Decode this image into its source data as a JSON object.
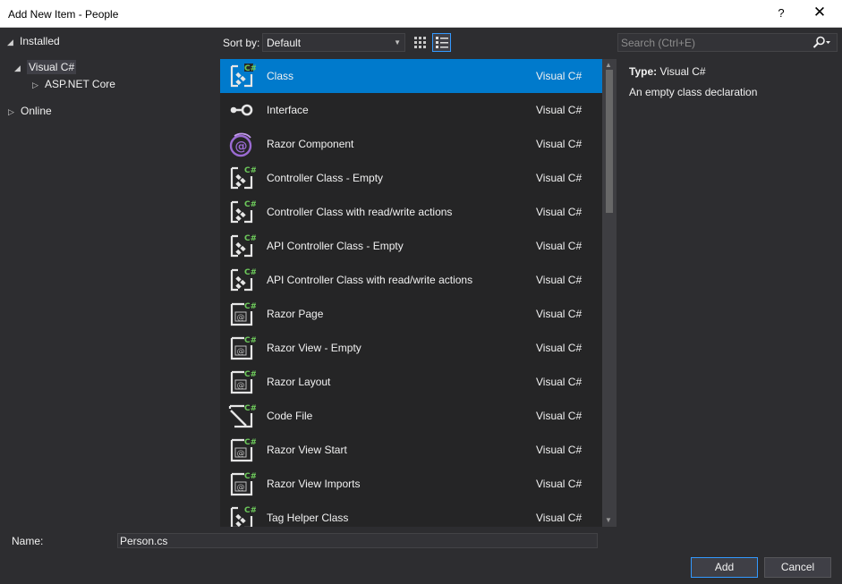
{
  "window": {
    "title": "Add New Item - People",
    "help_glyph": "?",
    "close_glyph": "✕"
  },
  "left_tree": {
    "installed": "Installed",
    "visual_csharp": "Visual C#",
    "aspnet_core": "ASP.NET Core",
    "online": "Online"
  },
  "toolbar": {
    "sort_label": "Sort by:",
    "sort_value": "Default",
    "search_placeholder": "Search (Ctrl+E)"
  },
  "templates": [
    {
      "name": "Class",
      "lang": "Visual C#",
      "icon": "class-icon"
    },
    {
      "name": "Interface",
      "lang": "Visual C#",
      "icon": "interface-icon"
    },
    {
      "name": "Razor Component",
      "lang": "Visual C#",
      "icon": "razor-component-icon"
    },
    {
      "name": "Controller Class - Empty",
      "lang": "Visual C#",
      "icon": "class-icon"
    },
    {
      "name": "Controller Class with read/write actions",
      "lang": "Visual C#",
      "icon": "class-icon"
    },
    {
      "name": "API Controller Class - Empty",
      "lang": "Visual C#",
      "icon": "class-icon"
    },
    {
      "name": "API Controller Class with read/write actions",
      "lang": "Visual C#",
      "icon": "class-icon"
    },
    {
      "name": "Razor Page",
      "lang": "Visual C#",
      "icon": "razor-page-icon"
    },
    {
      "name": "Razor View - Empty",
      "lang": "Visual C#",
      "icon": "razor-page-icon"
    },
    {
      "name": "Razor Layout",
      "lang": "Visual C#",
      "icon": "razor-page-icon"
    },
    {
      "name": "Code File",
      "lang": "Visual C#",
      "icon": "code-file-icon"
    },
    {
      "name": "Razor View Start",
      "lang": "Visual C#",
      "icon": "razor-page-icon"
    },
    {
      "name": "Razor View Imports",
      "lang": "Visual C#",
      "icon": "razor-page-icon"
    },
    {
      "name": "Tag Helper Class",
      "lang": "Visual C#",
      "icon": "class-icon"
    }
  ],
  "selected_index": 0,
  "detail": {
    "type_label": "Type:",
    "type_value": "Visual C#",
    "description": "An empty class declaration"
  },
  "footer": {
    "name_label": "Name:",
    "name_value": "Person.cs",
    "add_label": "Add",
    "cancel_label": "Cancel"
  },
  "colors": {
    "accent": "#007acc",
    "background": "#2d2d30",
    "list_background": "#252526",
    "csharp_badge": "#6dc95b",
    "razor_purple": "#9b6bd3"
  }
}
